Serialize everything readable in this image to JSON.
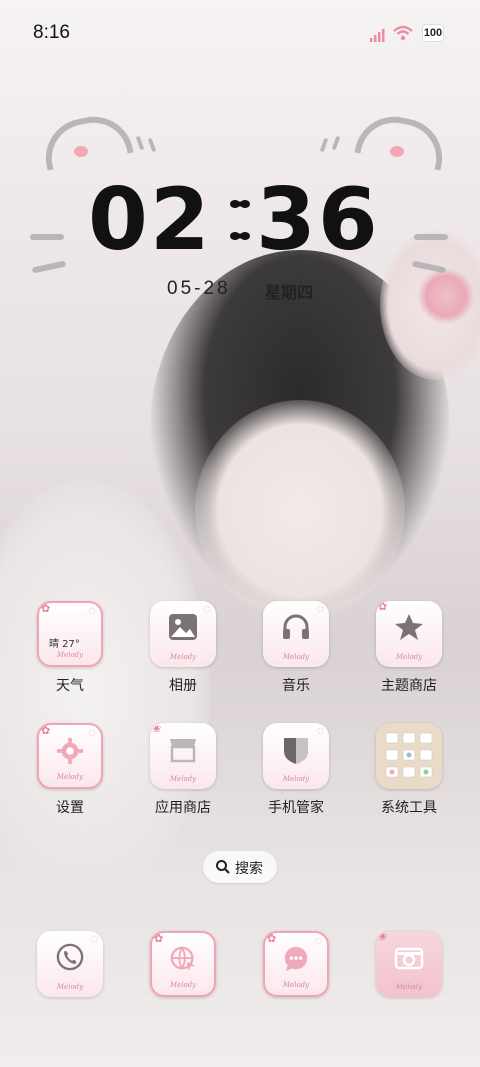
{
  "status_bar": {
    "time": "8:16",
    "battery": "100",
    "icons": [
      "signal-icon",
      "wifi-icon",
      "battery-icon"
    ]
  },
  "lock_clock": {
    "hours": "02",
    "minutes": "36",
    "date": "05-28",
    "weekday": "星期四"
  },
  "apps_row1": [
    {
      "label": "天气",
      "icon": "weather-icon",
      "weather": "晴 27°"
    },
    {
      "label": "相册",
      "icon": "gallery-icon"
    },
    {
      "label": "音乐",
      "icon": "headphones-icon"
    },
    {
      "label": "主题商店",
      "icon": "star-icon"
    }
  ],
  "apps_row2": [
    {
      "label": "设置",
      "icon": "gear-icon"
    },
    {
      "label": "应用商店",
      "icon": "store-icon"
    },
    {
      "label": "手机管家",
      "icon": "shield-icon"
    },
    {
      "label": "系统工具",
      "icon": "folder-icon"
    }
  ],
  "search": {
    "label": "搜索",
    "icon": "search-icon"
  },
  "dock": [
    {
      "icon": "phone-icon"
    },
    {
      "icon": "browser-icon"
    },
    {
      "icon": "message-icon"
    },
    {
      "icon": "camera-icon"
    }
  ],
  "melody_text": "Melody",
  "colors": {
    "accent": "#f1a4b6",
    "text": "#222222"
  }
}
